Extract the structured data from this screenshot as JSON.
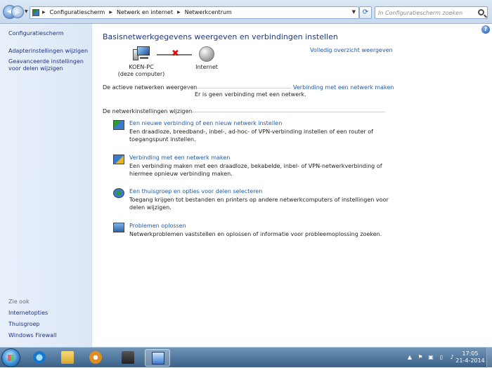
{
  "address_bar": {
    "crumbs": [
      "Configuratiescherm",
      "Netwerk en internet",
      "Netwerkcentrum"
    ],
    "search_placeholder": "In Configuratiescherm zoeken"
  },
  "sidebar": {
    "home": "Configuratiescherm",
    "links": [
      "Adapterinstellingen wijzigen",
      "Geavanceerde instellingen voor delen wijzigen"
    ],
    "see_also_title": "Zie ook",
    "see_also": [
      "Internetopties",
      "Thuisgroep",
      "Windows Firewall"
    ]
  },
  "main": {
    "title": "Basisnetwerkgegevens weergeven en verbindingen instellen",
    "full_view_link": "Volledig overzicht weergeven",
    "computer_name": "KOEN-PC",
    "computer_sub": "(deze computer)",
    "internet_label": "Internet",
    "active_networks_heading": "De actieve netwerken weergeven",
    "connect_link": "Verbinding met een netwerk maken",
    "no_connection": "Er is geen verbinding met een netwerk.",
    "settings_heading": "De netwerkinstellingen wijzigen",
    "tasks": [
      {
        "link": "Een nieuwe verbinding of een nieuw netwerk instellen",
        "desc": "Een draadloze, breedband-, inbel-, ad-hoc- of VPN-verbinding instellen of een router of toegangspunt instellen."
      },
      {
        "link": "Verbinding met een netwerk maken",
        "desc": "Een verbinding maken met een draadloze, bekabelde, inbel- of VPN-netwerkverbinding of hiermee opnieuw verbinding maken."
      },
      {
        "link": "Een thuisgroep en opties voor delen selecteren",
        "desc": "Toegang krijgen tot bestanden en printers op andere netwerkcomputers of instellingen voor delen wijzigen."
      },
      {
        "link": "Problemen oplossen",
        "desc": "Netwerkproblemen vaststellen en oplossen of informatie voor probleemoplossing zoeken."
      }
    ]
  },
  "taskbar": {
    "time": "17:05",
    "date": "21-4-2014"
  }
}
